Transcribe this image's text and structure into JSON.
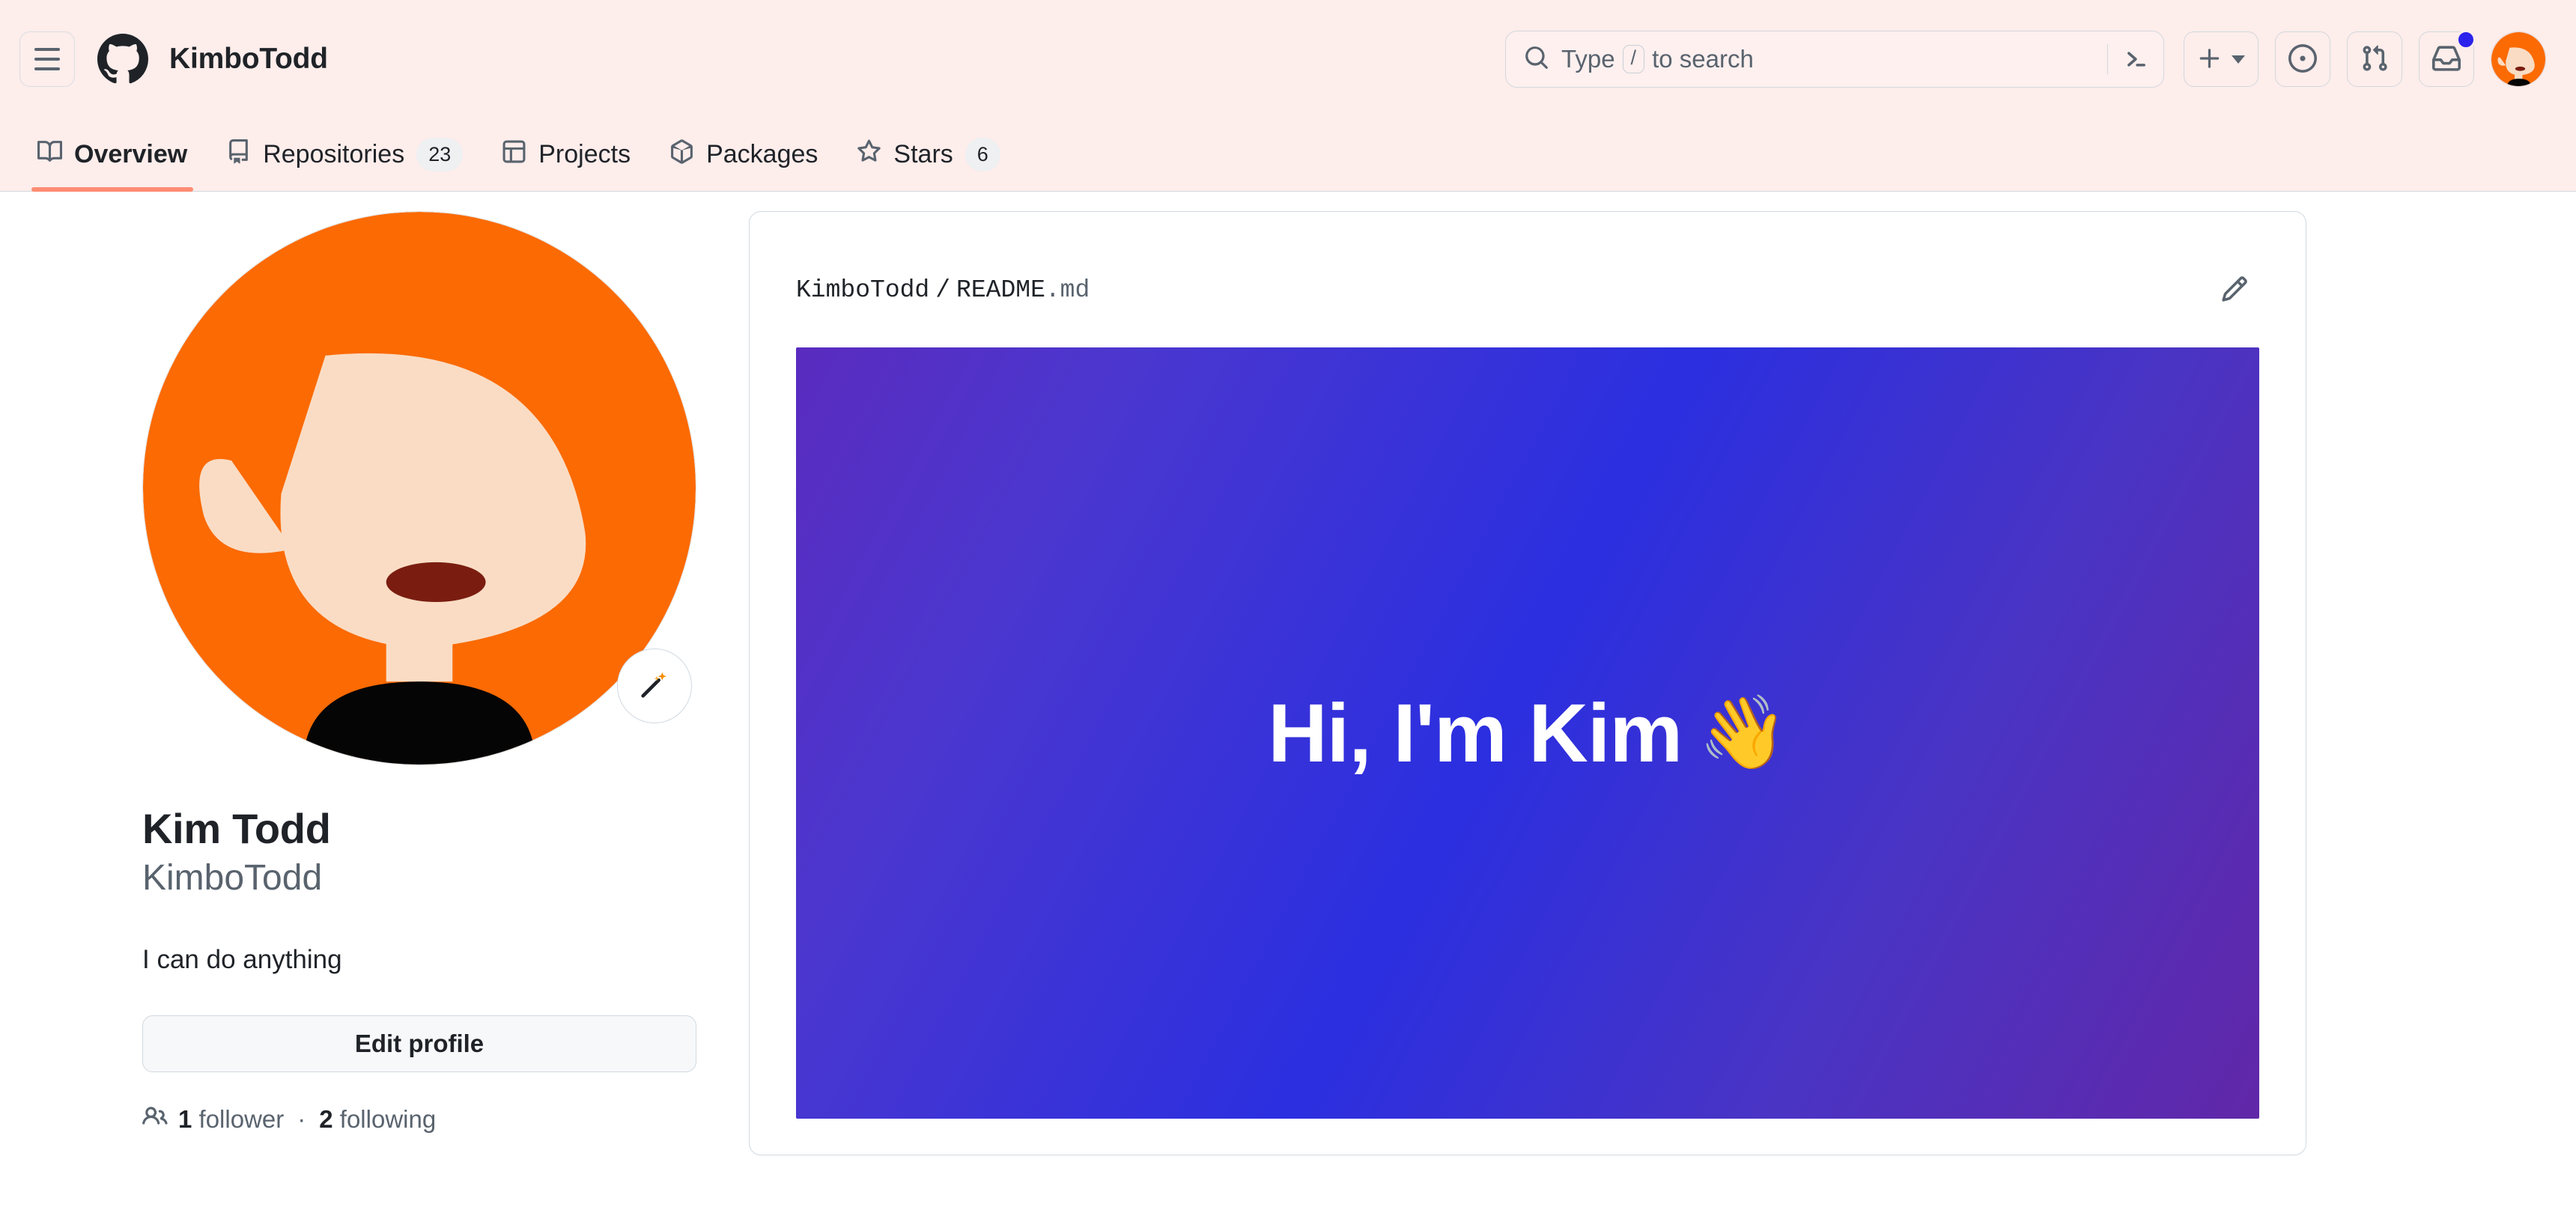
{
  "header": {
    "menu_icon": "hamburger-icon",
    "logo_icon": "github-mark-icon",
    "owner": "KimboTodd",
    "search": {
      "icon": "search-icon",
      "placeholder_prefix": "Type",
      "placeholder_key": "/",
      "placeholder_suffix": "to search",
      "terminal_icon": "terminal-prompt-icon"
    },
    "actions": {
      "create_icon": "plus-icon",
      "create_caret_icon": "chevron-down-icon",
      "issues_icon": "issue-opened-icon",
      "pull_requests_icon": "git-pull-request-icon",
      "inbox_icon": "inbox-icon",
      "inbox_has_unread": true,
      "notification_dot_color": "#2b22ec",
      "avatar_icon": "user-avatar"
    }
  },
  "nav": {
    "tabs": [
      {
        "label": "Overview",
        "icon": "book-icon",
        "count": null,
        "active": true
      },
      {
        "label": "Repositories",
        "icon": "repo-icon",
        "count": "23",
        "active": false
      },
      {
        "label": "Projects",
        "icon": "project-icon",
        "count": null,
        "active": false
      },
      {
        "label": "Packages",
        "icon": "package-icon",
        "count": null,
        "active": false
      },
      {
        "label": "Stars",
        "icon": "star-icon",
        "count": "6",
        "active": false
      }
    ],
    "active_underline_color": "#fd8c73",
    "background_color": "#fdedeb"
  },
  "profile": {
    "avatar_alt": "Kim Todd avatar",
    "avatar_edit_icon": "magic-wand-icon",
    "full_name": "Kim Todd",
    "login": "KimboTodd",
    "bio": "I can do anything",
    "edit_profile_label": "Edit profile",
    "followers_icon": "people-icon",
    "followers_count": "1",
    "followers_label": "follower",
    "separator": "·",
    "following_count": "2",
    "following_label": "following"
  },
  "readme": {
    "owner": "KimboTodd",
    "separator": "/",
    "filename": "README",
    "extension": ".md",
    "edit_icon": "pencil-icon",
    "hero_text": "Hi, I'm Kim",
    "hero_emoji": "👋",
    "gradient_start": "#5a2bbf",
    "gradient_mid": "#2b2fe0",
    "gradient_end": "#6127a8"
  }
}
